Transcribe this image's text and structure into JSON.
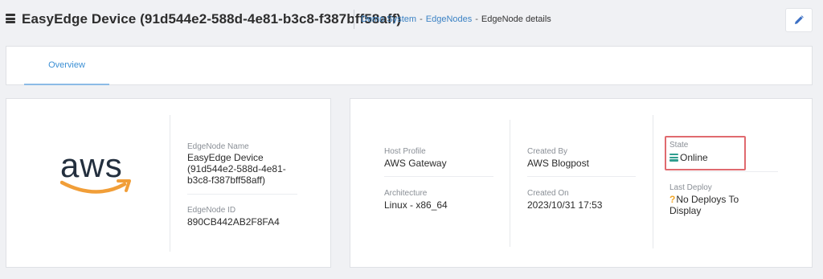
{
  "header": {
    "title": "EasyEdge Device (91d544e2-588d-4e81-b3c8-f387bff58aff)",
    "icon": "device-stack-icon",
    "breadcrumb": {
      "link1": "Demo System",
      "sep1": "-",
      "link2": "EdgeNodes",
      "sep2": "-",
      "current": "EdgeNode details"
    },
    "edit_icon": "pencil-icon"
  },
  "tabs": [
    {
      "label": "Overview",
      "active": true
    }
  ],
  "left_card": {
    "logo_text": "aws",
    "logo_icon": "aws-logo",
    "name_label": "EdgeNode Name",
    "name_lines": [
      "EasyEdge Device",
      "(91d544e2-588d-4e81-",
      "b3c8-f387bff58aff)"
    ],
    "id_label": "EdgeNode ID",
    "id_value": "890CB442AB2F8FA4"
  },
  "right_card": {
    "host_profile_label": "Host Profile",
    "host_profile_value": "AWS Gateway",
    "architecture_label": "Architecture",
    "architecture_value": "Linux - x86_64",
    "created_by_label": "Created By",
    "created_by_value": "AWS Blogpost",
    "created_on_label": "Created On",
    "created_on_value": "2023/10/31 17:53",
    "state_label": "State",
    "state_value": "Online",
    "state_icon": "online-stack-icon",
    "last_deploy_label": "Last Deploy",
    "last_deploy_icon": "question-icon",
    "last_deploy_lines": [
      "No Deploys To",
      "Display"
    ]
  },
  "colors": {
    "accent": "#3b8fd4",
    "link": "#3b82c4",
    "state_highlight": "#e06a6f",
    "online": "#2f9e8f",
    "warning": "#f2a72a"
  }
}
